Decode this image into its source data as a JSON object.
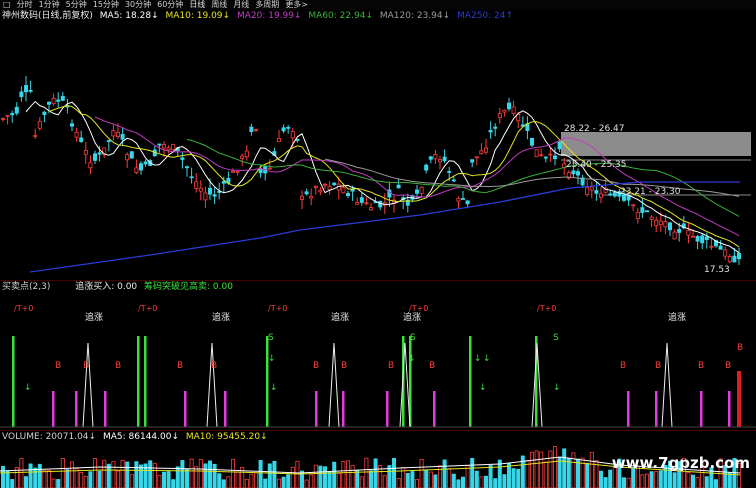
{
  "toolbar": {
    "items": [
      "□",
      "分时",
      "1分钟",
      "5分钟",
      "15分钟",
      "30分钟",
      "60分钟",
      "日线",
      "周线",
      "月线",
      "多周期",
      "更多>"
    ]
  },
  "main_legend": {
    "title": "神州数码(日线,前复权)",
    "ma5": "MA5: 18.28↓",
    "ma10": "MA10: 19.09↓",
    "ma20": "MA20: 19.99↓",
    "ma60": "MA60: 22.94↓",
    "ma120": "MA120: 23.94↓",
    "ma250": "MA250: 24↑"
  },
  "price_labels": {
    "band1": "28.22 - 26.47",
    "band2": "25.40 - 25.35",
    "band3": "23.21 - 23.30",
    "low": "17.53"
  },
  "signal_legend": {
    "name": "买卖点(2,3)",
    "chase": "追涨买入: 0.00",
    "chip": "筹码突破见高卖: 0.00"
  },
  "signal_labels": {
    "chase_text": "追涨",
    "t_text": "/T+0",
    "b_text": "B",
    "s_text": "S",
    "s_mark": "S"
  },
  "volume_legend": {
    "volume": "VOLUME: 20071.04↓",
    "ma5": "MA5: 86144.00↓",
    "ma10": "MA10: 95455.20↓"
  },
  "watermark": "www.7gpzb.com",
  "colors": {
    "up": "#ff3c3c",
    "down": "#36d6e8",
    "ma5": "#ffffff",
    "ma10": "#e5e51a",
    "ma20": "#c23cc2",
    "ma60": "#3ab03a",
    "ma120": "#9a9a9a",
    "ma250": "#2d3bd6",
    "signal_green": "#3adf3a",
    "signal_magenta": "#e23ce2"
  }
}
